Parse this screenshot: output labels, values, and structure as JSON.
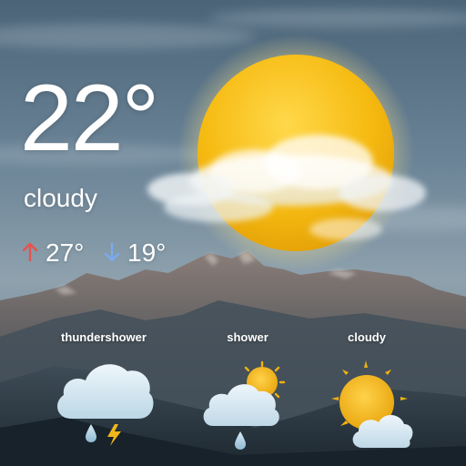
{
  "current": {
    "temperature": "22°",
    "condition": "cloudy",
    "high": "27°",
    "low": "19°",
    "icon": "partly-cloudy-sun-icon"
  },
  "forecast": [
    {
      "label": "thundershower",
      "icon": "thundershower-icon"
    },
    {
      "label": "shower",
      "icon": "shower-icon"
    },
    {
      "label": "cloudy",
      "icon": "cloudy-sun-icon"
    }
  ],
  "colors": {
    "sun": "#f2b70c",
    "high_arrow": "#e8524d",
    "low_arrow": "#7aaaf0",
    "text": "#ffffff"
  }
}
